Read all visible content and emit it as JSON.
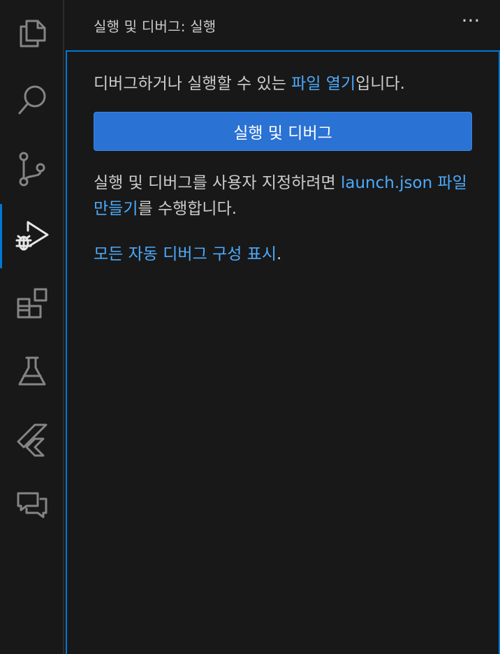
{
  "activity_bar": {
    "items": [
      {
        "icon": "files-icon",
        "active": false
      },
      {
        "icon": "search-icon",
        "active": false
      },
      {
        "icon": "source-control-icon",
        "active": false
      },
      {
        "icon": "run-debug-icon",
        "active": true
      },
      {
        "icon": "extensions-icon",
        "active": false
      },
      {
        "icon": "testing-icon",
        "active": false
      },
      {
        "icon": "flutter-icon",
        "active": false
      },
      {
        "icon": "chat-icon",
        "active": false
      }
    ],
    "colors": {
      "accent": "#0078d4",
      "inactive_icon": "#858585",
      "active_icon": "#e6e6e6"
    }
  },
  "sidebar": {
    "title": "실행 및 디버그: 실행",
    "more_label": "···"
  },
  "panel": {
    "open_file_prefix": "디버그하거나 실행할 수 있는 ",
    "open_file_link": "파일 열기",
    "open_file_suffix": "입니다.",
    "run_button_label": "실행 및 디버그",
    "launch_prefix": "실행 및 디버그를 사용자 지정하려면 ",
    "launch_link": "launch.json 파일 만들기",
    "launch_suffix": "를 수행합니다.",
    "auto_link": "모든 자동 디버그 구성 표시",
    "auto_suffix": "."
  },
  "colors": {
    "background": "#181818",
    "text": "#cccccc",
    "link": "#4daafc",
    "button": "#2a72d3",
    "focus_border": "#0078d4"
  }
}
